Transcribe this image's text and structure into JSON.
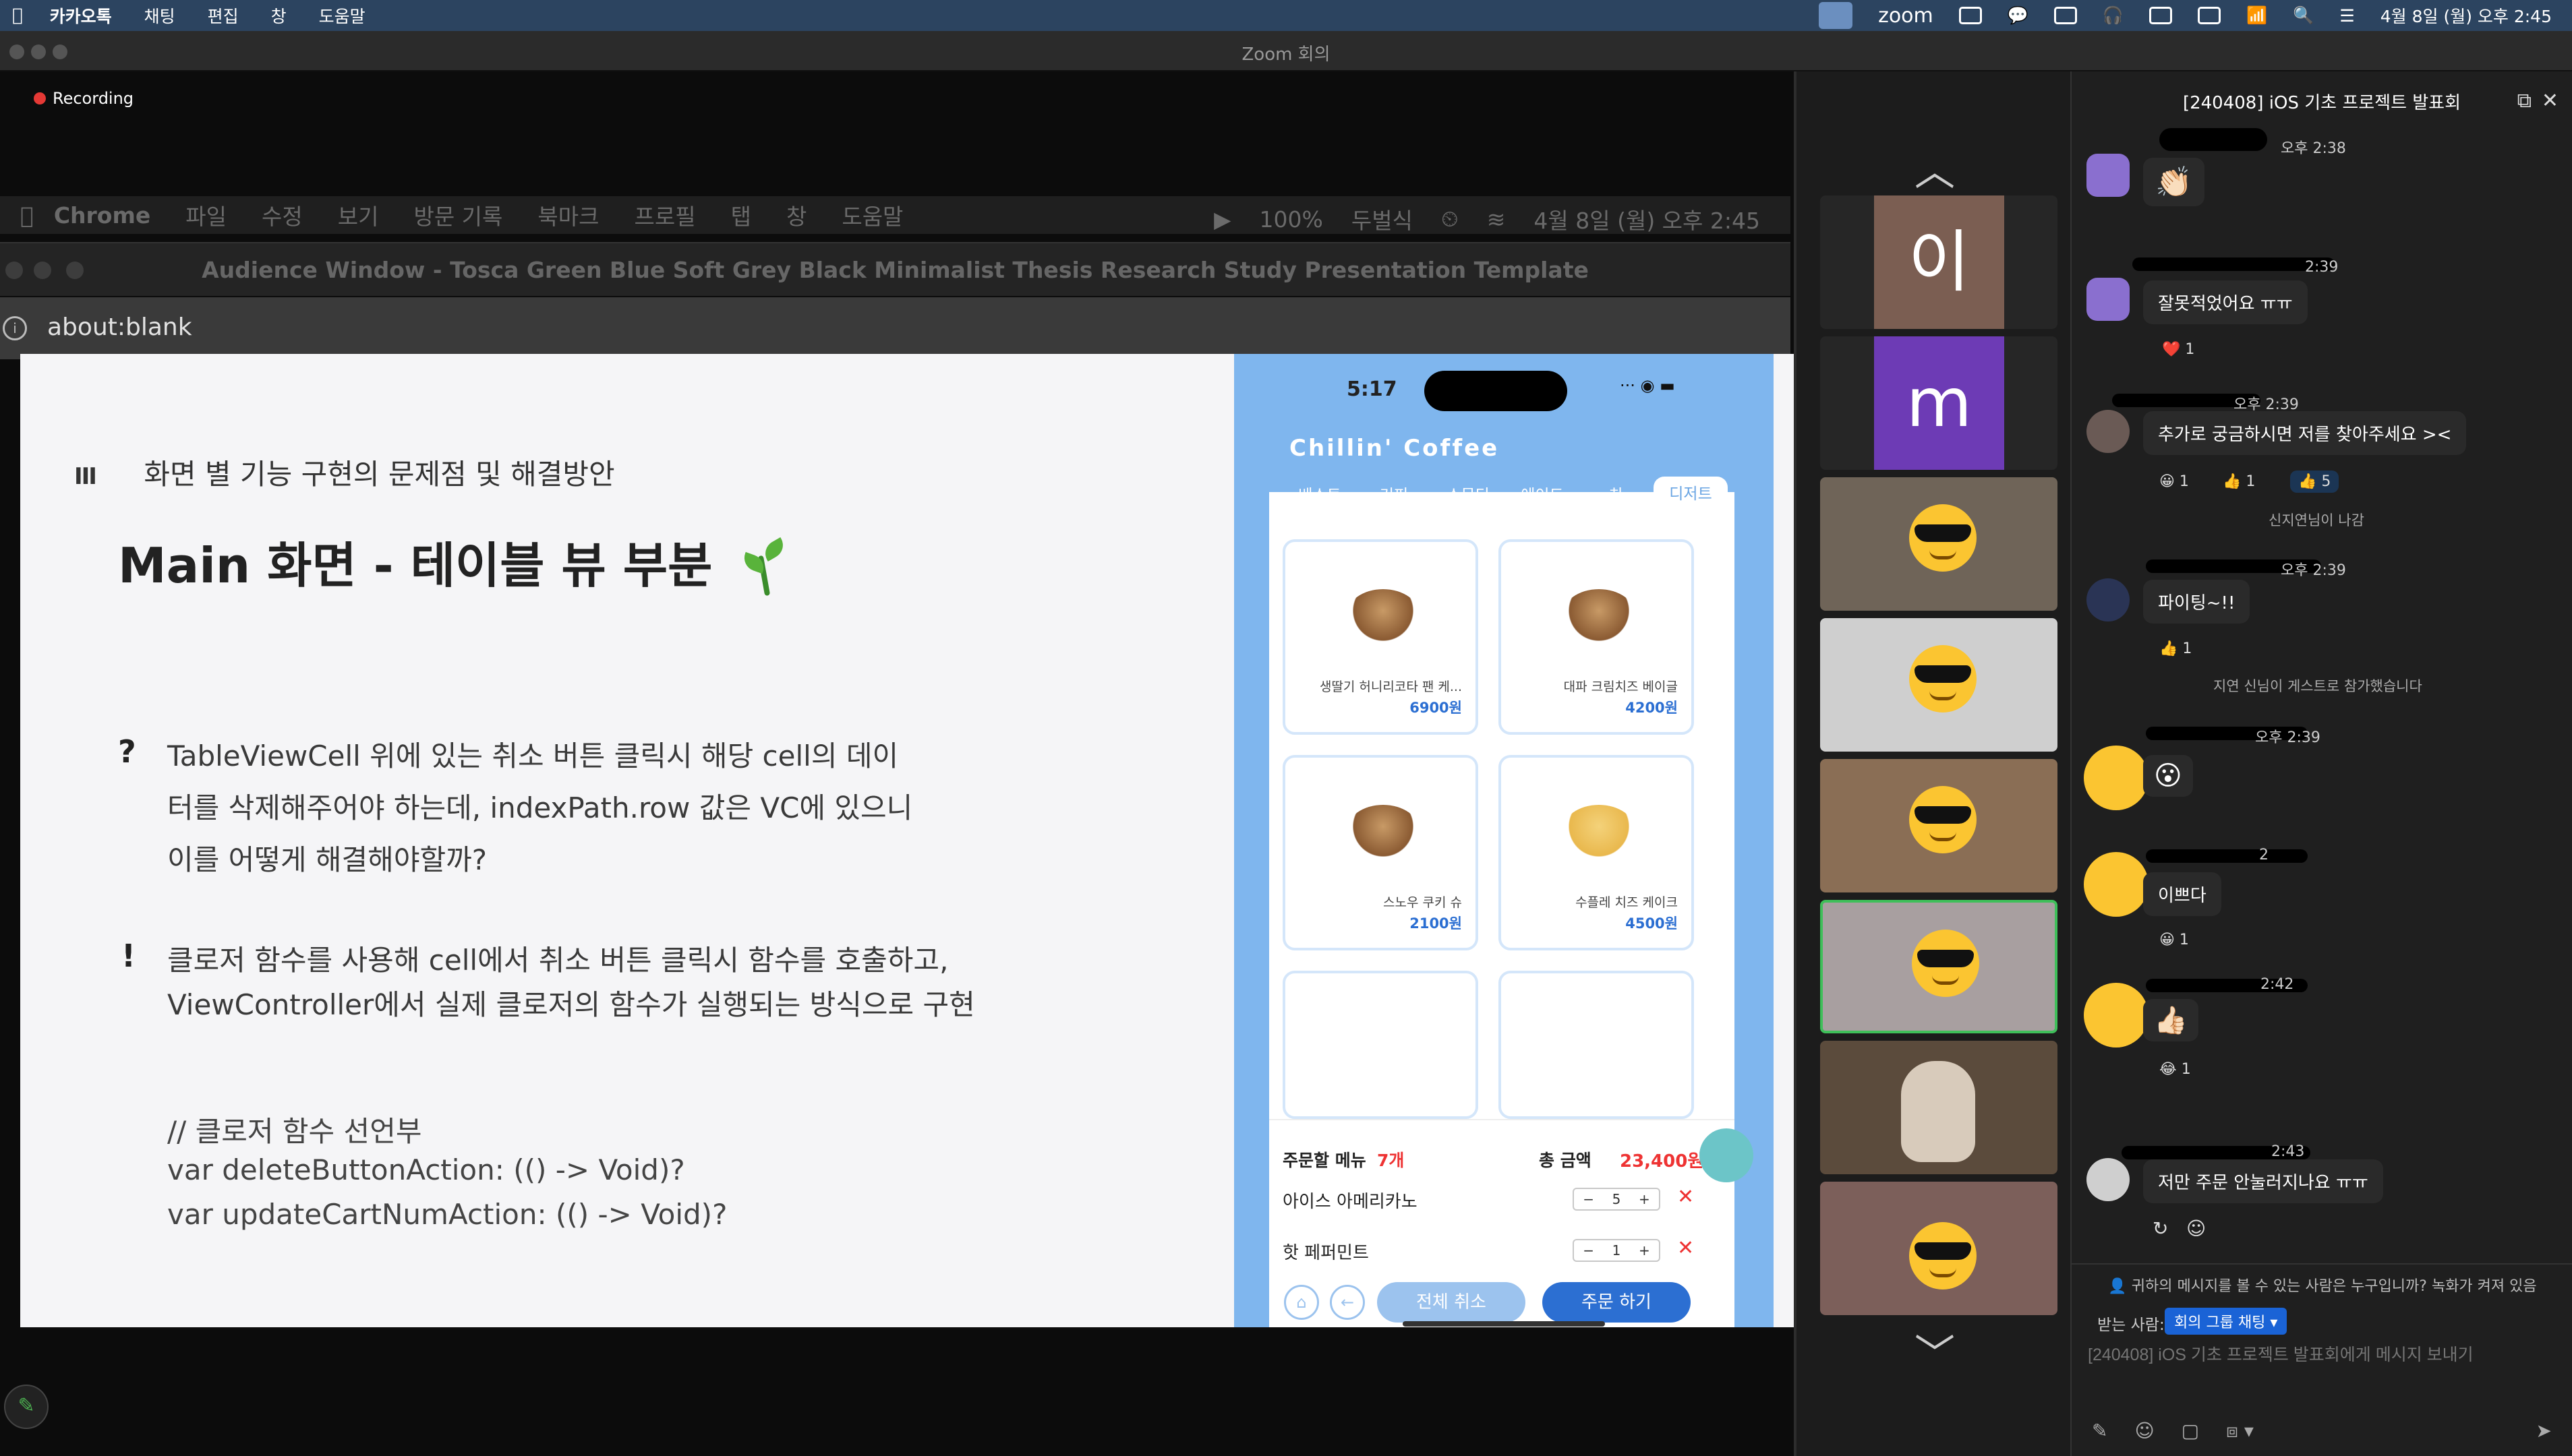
{
  "menubar": {
    "apple": "",
    "items": [
      "카카오톡",
      "채팅",
      "편집",
      "창",
      "도움말"
    ],
    "zoom_label": "zoom",
    "datetime": "4월 8일 (월) 오후 2:45"
  },
  "zoom_window": {
    "title": "Zoom 회의",
    "recording": "Recording"
  },
  "shared_screen": {
    "menubar_items": [
      "Chrome",
      "파일",
      "수정",
      "보기",
      "방문 기록",
      "북마크",
      "프로필",
      "탭",
      "창",
      "도움말"
    ],
    "menubar_right": {
      "zoom": "100%",
      "input": "두벌식",
      "datetime": "4월 8일 (월) 오후 2:45"
    },
    "window_title": "Audience Window - Tosca Green Blue Soft Grey Black Minimalist Thesis Research Study Presentation Template",
    "url": "about:blank"
  },
  "slide": {
    "section_bars": "III",
    "section": "화면 별 기능 구현의 문제점 및 해결방안",
    "title": "Main 화면 - 테이블 뷰 부분",
    "question_mark": "?",
    "question_lines": [
      "TableViewCell 위에 있는 취소 버튼 클릭시 해당 cell의 데이",
      "터를 삭제해주어야 하는데, indexPath.row 값은 VC에 있으니",
      "이를 어떻게 해결해야할까?"
    ],
    "answer_mark": "!",
    "answer_lines": [
      "클로저 함수를 사용해 cell에서 취소 버튼 클릭시 함수를 호출하고,",
      "ViewController에서 실제 클로저의 함수가 실행되는 방식으로 구현"
    ],
    "code_lines": [
      "// 클로저 함수 선언부",
      "var deleteButtonAction: (() -> Void)?",
      "var updateCartNumAction: (() -> Void)?"
    ]
  },
  "phone": {
    "time": "5:17",
    "app_title": "Chillin' Coffee",
    "tabs": [
      "베스트",
      "커피",
      "스무디",
      "에이드",
      "차",
      "디저트"
    ],
    "active_tab": 5,
    "products": [
      {
        "name": "생딸기 허니리코타 팬 케...",
        "price": "6900원"
      },
      {
        "name": "대파 크림치즈 베이글",
        "price": "4200원"
      },
      {
        "name": "스노우 쿠키 슈",
        "price": "2100원"
      },
      {
        "name": "수플레 치즈 케이크",
        "price": "4500원"
      }
    ],
    "order": {
      "label": "주문할 메뉴",
      "count": "7개",
      "total_label": "총 금액",
      "total": "23,400원",
      "items": [
        {
          "name": "아이스 아메리카노",
          "qty": "5"
        },
        {
          "name": "핫 페퍼민트",
          "qty": "1"
        }
      ],
      "cancel_all": "전체 취소",
      "order_btn": "주문 하기"
    }
  },
  "gallery": {
    "name_tiles": [
      "이",
      "m"
    ],
    "name_tile_colors": [
      "#7b5e52",
      "#6d3bb5"
    ]
  },
  "chat": {
    "title": "[240408] iOS 기초 프로젝트 발표회",
    "messages": [
      {
        "time": "오후 2:38",
        "text": "👏🏻"
      },
      {
        "time": "2:39",
        "text": "잘못적었어요 ㅠㅠ",
        "reaction": "❤️ 1"
      },
      {
        "time": "오후 2:39",
        "text": "추가로 궁금하시면 저를 찾아주세요 ><",
        "reactions": [
          "😀 1",
          "👍 1",
          "👍 5"
        ]
      },
      {
        "time": "오후 2:39",
        "text": "파이팅~!!",
        "reaction": "👍 1"
      },
      {
        "time": "오후 2:39",
        "text": "😮"
      },
      {
        "time": "2",
        "text": "이쁘다",
        "reaction": "😀 1"
      },
      {
        "time": "2:42",
        "text": "👍🏻",
        "reaction": "😂 1"
      },
      {
        "time": "2:43",
        "text": "저만 주문 안눌러지나요 ㅠㅠ"
      }
    ],
    "system_notes": [
      "신지연님이 나감",
      "지연 신님이 게스트로 참가했습니다"
    ],
    "privacy_notice": "귀하의 메시지를 볼 수 있는 사람은 누구입니까? 녹화가 켜져 있음",
    "to_label": "받는 사람:",
    "to_target": "회의 그룹 채팅 ▾",
    "input_placeholder": "[240408] iOS 기초 프로젝트 발표회에게 메시지 보내기"
  }
}
